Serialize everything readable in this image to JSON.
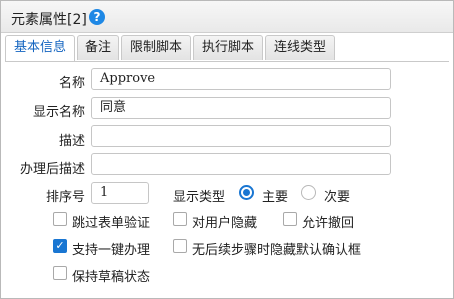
{
  "title": {
    "text": "元素属性[2]",
    "help_icon": "question-circle-icon"
  },
  "tabs": [
    {
      "label": "基本信息",
      "active": true
    },
    {
      "label": "备注",
      "active": false
    },
    {
      "label": "限制脚本",
      "active": false
    },
    {
      "label": "执行脚本",
      "active": false
    },
    {
      "label": "连线类型",
      "active": false
    }
  ],
  "form": {
    "name": {
      "label": "名称",
      "value": "Approve"
    },
    "display_name": {
      "label": "显示名称",
      "value": "同意"
    },
    "description": {
      "label": "描述",
      "value": ""
    },
    "post_description": {
      "label": "办理后描述",
      "value": ""
    },
    "order": {
      "label": "排序号",
      "value": "1"
    },
    "display_type": {
      "label": "显示类型",
      "options": [
        {
          "label": "主要",
          "selected": true
        },
        {
          "label": "次要",
          "selected": false
        }
      ]
    },
    "checkboxes": {
      "skip_validation": {
        "label": "跳过表单验证",
        "checked": false
      },
      "hide_from_user": {
        "label": "对用户隐藏",
        "checked": false
      },
      "allow_revoke": {
        "label": "允许撤回",
        "checked": false
      },
      "one_click": {
        "label": "支持一键办理",
        "checked": true
      },
      "hide_confirm": {
        "label": "无后续步骤时隐藏默认确认框",
        "checked": false
      },
      "keep_draft": {
        "label": "保持草稿状态",
        "checked": false
      }
    }
  },
  "colors": {
    "accent": "#1976d2",
    "active_tab_text": "#1565c0"
  }
}
